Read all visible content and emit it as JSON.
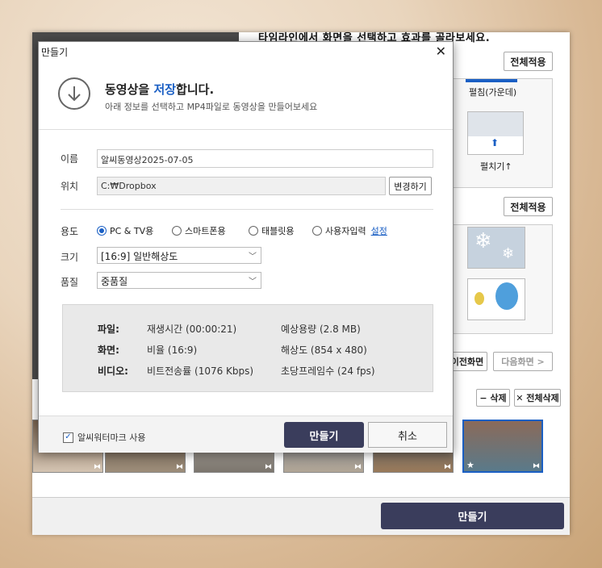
{
  "background": {
    "header": "타임라인에서 화면을 선택하고 효과를 골라보세요.",
    "apply_all_1": "전체적용",
    "apply_all_2": "전체적용",
    "transition_label_1": "펼침(가운데)",
    "transition_label_2": "펼치기↑",
    "prev_screen": "이전화면",
    "next_screen": "다음화면 >",
    "delete": "− 삭제",
    "delete_all": "✕ 전체삭제",
    "make_button": "만들기"
  },
  "dialog": {
    "title": "만들기",
    "heading_pre": "동영상을 ",
    "heading_hl": "저장",
    "heading_post": "합니다.",
    "subtitle": "아래 정보를 선택하고 MP4파일로 동영상을 만들어보세요",
    "name_label": "이름",
    "name_value": "알씨동영상2025-07-05",
    "location_label": "위치",
    "location_value": "C:₩Dropbox",
    "change_button": "변경하기",
    "purpose_label": "용도",
    "purposes": [
      "PC & TV용",
      "스마트폰용",
      "태블릿용",
      "사용자입력"
    ],
    "settings_link": "설정",
    "size_label": "크기",
    "size_value": "[16:9] 일반해상도",
    "quality_label": "품질",
    "quality_value": "중품질",
    "info": {
      "file_key": "파일:",
      "file_value": "재생시간 (00:00:21)",
      "file_value2": "예상용량 (2.8 MB)",
      "screen_key": "화면:",
      "screen_value": "비율 (16:9)",
      "screen_value2": "해상도 (854 x 480)",
      "video_key": "비디오:",
      "video_value": "비트전송률 (1076 Kbps)",
      "video_value2": "초당프레임수 (24 fps)"
    },
    "watermark_label": "알씨워터마크 사용",
    "ok_button": "만들기",
    "cancel_button": "취소"
  },
  "colors": {
    "accent": "#1a5fc4",
    "primary_button": "#3a3d5c"
  }
}
